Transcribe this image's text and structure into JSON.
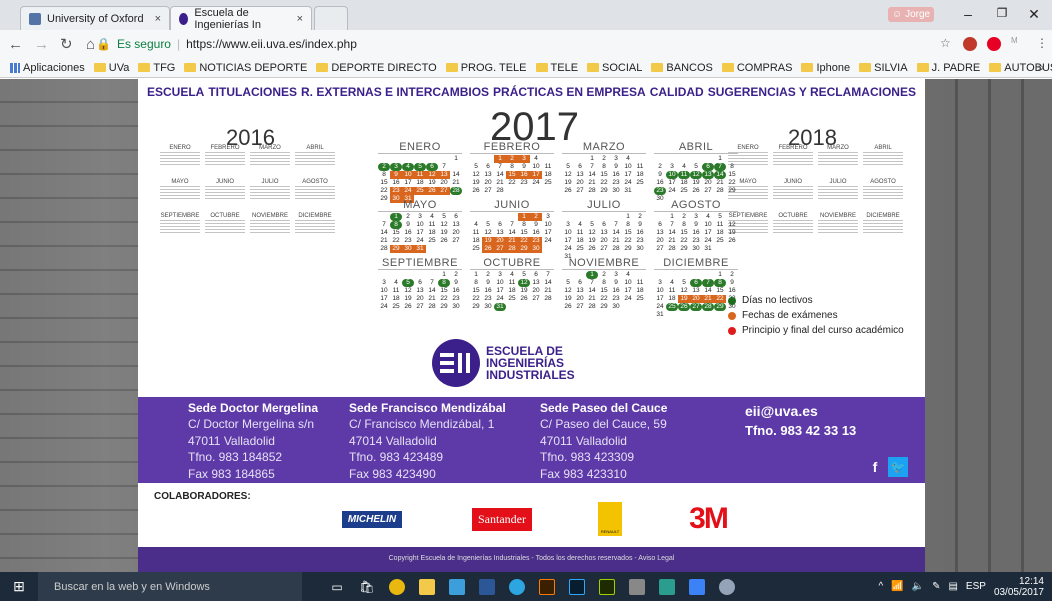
{
  "tabs": [
    {
      "title": "University of Oxford",
      "color": "#5474a8"
    },
    {
      "title": "Escuela de Ingenierías In",
      "color": "#3b1f8a"
    }
  ],
  "user": "Jorge",
  "secure_label": "Es seguro",
  "url": "https://www.eii.uva.es/index.php",
  "bookmarks": [
    "Aplicaciones",
    "UVa",
    "TFG",
    "NOTICIAS DEPORTE",
    "DEPORTE DIRECTO",
    "PROG. TELE",
    "TELE",
    "SOCIAL",
    "BANCOS",
    "COMPRAS",
    "Iphone",
    "SILVIA",
    "J. PADRE",
    "AUTOBUSES"
  ],
  "nav": [
    "ESCUELA",
    "TITULACIONES",
    "R. EXTERNAS E INTERCAMBIOS",
    "PRÁCTICAS EN EMPRESA",
    "CALIDAD",
    "SUGERENCIAS Y RECLAMACIONES"
  ],
  "years": {
    "prev": "2016",
    "curr": "2017",
    "next": "2018"
  },
  "mini_months": [
    "ENERO",
    "FEBRERO",
    "MARZO",
    "ABRIL",
    "MAYO",
    "JUNIO",
    "JULIO",
    "AGOSTO",
    "SEPTIEMBRE",
    "OCTUBRE",
    "NOVIEMBRE",
    "DICIEMBRE"
  ],
  "months_2017": [
    {
      "name": "ENERO",
      "rows": [
        [
          "",
          "",
          "",
          "",
          "",
          "",
          "1"
        ],
        [
          "2",
          "3",
          "4",
          "5",
          "6",
          "7",
          ""
        ],
        [
          "8",
          "9",
          "10",
          "11",
          "12",
          "13",
          "14"
        ],
        [
          "15",
          "16",
          "17",
          "18",
          "19",
          "20",
          "21"
        ],
        [
          "22",
          "23",
          "24",
          "25",
          "26",
          "27",
          "28"
        ],
        [
          "29",
          "30",
          "31",
          "",
          "",
          "",
          ""
        ]
      ],
      "marks": {
        "2": "g",
        "3": "g",
        "4": "g",
        "5": "g",
        "6": "g",
        "9": "o",
        "10": "o",
        "11": "o",
        "12": "o",
        "13": "o",
        "23": "o",
        "24": "o",
        "25": "o",
        "26": "o",
        "27": "o",
        "28": "g",
        "30": "o",
        "31": "o"
      }
    },
    {
      "name": "FEBRERO",
      "rows": [
        [
          "",
          "",
          "1",
          "2",
          "3",
          "4",
          ""
        ],
        [
          "5",
          "6",
          "7",
          "8",
          "9",
          "10",
          "11"
        ],
        [
          "12",
          "13",
          "14",
          "15",
          "16",
          "17",
          "18"
        ],
        [
          "19",
          "20",
          "21",
          "22",
          "23",
          "24",
          "25"
        ],
        [
          "26",
          "27",
          "28",
          "",
          "",
          "",
          ""
        ]
      ],
      "marks": {
        "1": "o",
        "2": "o",
        "3": "o",
        "15": "o",
        "16": "o",
        "17": "o"
      }
    },
    {
      "name": "MARZO",
      "rows": [
        [
          "",
          "",
          "1",
          "2",
          "3",
          "4",
          ""
        ],
        [
          "5",
          "6",
          "7",
          "8",
          "9",
          "10",
          "11"
        ],
        [
          "12",
          "13",
          "14",
          "15",
          "16",
          "17",
          "18"
        ],
        [
          "19",
          "20",
          "21",
          "22",
          "23",
          "24",
          "25"
        ],
        [
          "26",
          "27",
          "28",
          "29",
          "30",
          "31",
          ""
        ]
      ],
      "marks": {}
    },
    {
      "name": "ABRIL",
      "rows": [
        [
          "",
          "",
          "",
          "",
          "",
          "1",
          ""
        ],
        [
          "2",
          "3",
          "4",
          "5",
          "6",
          "7",
          "8"
        ],
        [
          "9",
          "10",
          "11",
          "12",
          "13",
          "14",
          "15"
        ],
        [
          "16",
          "17",
          "18",
          "19",
          "20",
          "21",
          "22"
        ],
        [
          "23",
          "24",
          "25",
          "26",
          "27",
          "28",
          "29"
        ],
        [
          "30",
          "",
          "",
          "",
          "",
          "",
          ""
        ]
      ],
      "marks": {
        "6": "g",
        "7": "g",
        "10": "g",
        "11": "g",
        "12": "g",
        "13": "g",
        "14": "g",
        "23": "g"
      }
    },
    {
      "name": "MAYO",
      "rows": [
        [
          "",
          "1",
          "2",
          "3",
          "4",
          "5",
          "6"
        ],
        [
          "7",
          "8",
          "9",
          "10",
          "11",
          "12",
          "13"
        ],
        [
          "14",
          "15",
          "16",
          "17",
          "18",
          "19",
          "20"
        ],
        [
          "21",
          "22",
          "23",
          "24",
          "25",
          "26",
          "27"
        ],
        [
          "28",
          "29",
          "30",
          "31",
          "",
          "",
          ""
        ]
      ],
      "marks": {
        "1": "g",
        "8": "g",
        "29": "o",
        "30": "o",
        "31": "o"
      }
    },
    {
      "name": "JUNIO",
      "rows": [
        [
          "",
          "",
          "",
          "",
          "1",
          "2",
          "3"
        ],
        [
          "4",
          "5",
          "6",
          "7",
          "8",
          "9",
          "10"
        ],
        [
          "11",
          "12",
          "13",
          "14",
          "15",
          "16",
          "17"
        ],
        [
          "18",
          "19",
          "20",
          "21",
          "22",
          "23",
          "24"
        ],
        [
          "25",
          "26",
          "27",
          "28",
          "29",
          "30",
          ""
        ]
      ],
      "marks": {
        "1": "o",
        "2": "o",
        "19": "o",
        "20": "o",
        "21": "o",
        "22": "o",
        "23": "o",
        "26": "o",
        "27": "o",
        "28": "o",
        "29": "o",
        "30": "o"
      }
    },
    {
      "name": "JULIO",
      "rows": [
        [
          "",
          "",
          "",
          "",
          "",
          "1",
          "2"
        ],
        [
          "3",
          "4",
          "5",
          "6",
          "7",
          "8",
          "9"
        ],
        [
          "10",
          "11",
          "12",
          "13",
          "14",
          "15",
          "16"
        ],
        [
          "17",
          "18",
          "19",
          "20",
          "21",
          "22",
          "23"
        ],
        [
          "24",
          "25",
          "26",
          "27",
          "28",
          "29",
          "30"
        ],
        [
          "31",
          "",
          "",
          "",
          "",
          "",
          ""
        ]
      ],
      "marks": {}
    },
    {
      "name": "AGOSTO",
      "rows": [
        [
          "",
          "1",
          "2",
          "3",
          "4",
          "5",
          ""
        ],
        [
          "6",
          "7",
          "8",
          "9",
          "10",
          "11",
          "12"
        ],
        [
          "13",
          "14",
          "15",
          "16",
          "17",
          "18",
          "19"
        ],
        [
          "20",
          "21",
          "22",
          "23",
          "24",
          "25",
          "26"
        ],
        [
          "27",
          "28",
          "29",
          "30",
          "31",
          "",
          ""
        ]
      ],
      "marks": {}
    },
    {
      "name": "SEPTIEMBRE",
      "rows": [
        [
          "",
          "",
          "",
          "",
          "",
          "1",
          "2"
        ],
        [
          "3",
          "4",
          "5",
          "6",
          "7",
          "8",
          "9"
        ],
        [
          "10",
          "11",
          "12",
          "13",
          "14",
          "15",
          "16"
        ],
        [
          "17",
          "18",
          "19",
          "20",
          "21",
          "22",
          "23"
        ],
        [
          "24",
          "25",
          "26",
          "27",
          "28",
          "29",
          "30"
        ]
      ],
      "marks": {
        "5": "g",
        "8": "g"
      }
    },
    {
      "name": "OCTUBRE",
      "rows": [
        [
          "1",
          "2",
          "3",
          "4",
          "5",
          "6",
          "7"
        ],
        [
          "8",
          "9",
          "10",
          "11",
          "12",
          "13",
          "14"
        ],
        [
          "15",
          "16",
          "17",
          "18",
          "19",
          "20",
          "21"
        ],
        [
          "22",
          "23",
          "24",
          "25",
          "26",
          "27",
          "28"
        ],
        [
          "29",
          "30",
          "31",
          "",
          "",
          "",
          ""
        ]
      ],
      "marks": {
        "12": "g",
        "31": "g"
      }
    },
    {
      "name": "NOVIEMBRE",
      "rows": [
        [
          "",
          "",
          "1",
          "2",
          "3",
          "4",
          ""
        ],
        [
          "5",
          "6",
          "7",
          "8",
          "9",
          "10",
          "11"
        ],
        [
          "12",
          "13",
          "14",
          "15",
          "16",
          "17",
          "18"
        ],
        [
          "19",
          "20",
          "21",
          "22",
          "23",
          "24",
          "25"
        ],
        [
          "26",
          "27",
          "28",
          "29",
          "30",
          "",
          ""
        ]
      ],
      "marks": {
        "1": "g"
      }
    },
    {
      "name": "DICIEMBRE",
      "rows": [
        [
          "",
          "",
          "",
          "",
          "",
          "1",
          "2"
        ],
        [
          "3",
          "4",
          "5",
          "6",
          "7",
          "8",
          "9"
        ],
        [
          "10",
          "11",
          "12",
          "13",
          "14",
          "15",
          "16"
        ],
        [
          "17",
          "18",
          "19",
          "20",
          "21",
          "22",
          "23"
        ],
        [
          "24",
          "25",
          "26",
          "27",
          "28",
          "29",
          "30"
        ],
        [
          "31",
          "",
          "",
          "",
          "",
          "",
          ""
        ]
      ],
      "marks": {
        "6": "g",
        "7": "g",
        "8": "g",
        "19": "o",
        "20": "o",
        "21": "o",
        "22": "o",
        "25": "g",
        "26": "g",
        "27": "g",
        "28": "g",
        "29": "g"
      }
    }
  ],
  "legend": [
    {
      "label": "Días no lectivos",
      "color": "#1e6b1e"
    },
    {
      "label": "Fechas de exámenes",
      "color": "#d9661e"
    },
    {
      "label": "Principio y final del curso académico",
      "color": "#e01b1b"
    }
  ],
  "school_name": "ESCUELA DE INGENIERÍAS INDUSTRIALES",
  "sedes": [
    {
      "title": "Sede Doctor Mergelina",
      "lines": [
        "C/ Doctor Mergelina s/n",
        "47011 Valladolid",
        "Tfno. 983 184852",
        "Fax 983 184865"
      ]
    },
    {
      "title": "Sede Francisco Mendizábal",
      "lines": [
        "C/ Francisco Mendizábal, 1",
        "47014 Valladolid",
        "Tfno. 983 423489",
        "Fax 983 423490"
      ]
    },
    {
      "title": "Sede Paseo del Cauce",
      "lines": [
        "C/ Paseo del Cauce, 59",
        "47011 Valladolid",
        "Tfno. 983 423309",
        "Fax 983 423310"
      ]
    }
  ],
  "email": "eii@uva.es",
  "phone": "Tfno. 983 42 33 13",
  "collab_label": "COLABORADORES:",
  "sponsors": {
    "michelin": "MICHELIN",
    "santander": "Santander",
    "renault": "RENAULT",
    "threem": "3M"
  },
  "copyright": "Copyright Escuela de Ingenierías Industriales - Todos los derechos reservados - Aviso Legal",
  "taskbar": {
    "search": "Buscar en la web y en Windows",
    "lang": "ESP",
    "time": "12:14",
    "date": "03/05/2017"
  }
}
